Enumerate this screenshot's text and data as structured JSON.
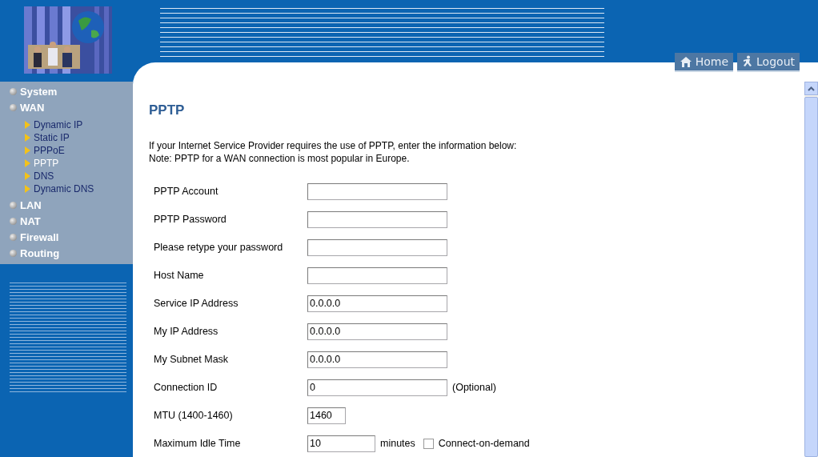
{
  "header": {
    "buttons": [
      {
        "label": "Home",
        "kind": "home"
      },
      {
        "label": "Logout",
        "kind": "logout"
      }
    ]
  },
  "sidebar": {
    "items": [
      {
        "label": "System"
      },
      {
        "label": "WAN",
        "children": [
          {
            "label": "Dynamic IP",
            "selected": false
          },
          {
            "label": "Static IP",
            "selected": false
          },
          {
            "label": "PPPoE",
            "selected": false
          },
          {
            "label": "PPTP",
            "selected": true
          },
          {
            "label": "DNS",
            "selected": false
          },
          {
            "label": "Dynamic DNS",
            "selected": false
          }
        ]
      },
      {
        "label": "LAN"
      },
      {
        "label": "NAT"
      },
      {
        "label": "Firewall"
      },
      {
        "label": "Routing"
      }
    ]
  },
  "page": {
    "title": "PPTP",
    "intro": [
      "If your Internet Service Provider requires the use of PPTP, enter the information below:",
      "Note: PPTP for a WAN connection is most popular in Europe."
    ],
    "fields": [
      {
        "label": "PPTP Account",
        "kind": "long"
      },
      {
        "label": "PPTP Password",
        "kind": "long"
      },
      {
        "label": "Please retype your password",
        "kind": "long"
      },
      {
        "label": "Host Name",
        "kind": "long"
      },
      {
        "label": "Service IP Address",
        "kind": "long",
        "value": "0.0.0.0"
      },
      {
        "label": "My IP Address",
        "kind": "long",
        "value": "0.0.0.0"
      },
      {
        "label": "My Subnet Mask",
        "kind": "long",
        "value": "0.0.0.0"
      },
      {
        "label": "Connection ID",
        "kind": "long",
        "value": "0",
        "note": "(Optional)"
      },
      {
        "label": "MTU (1400-1460)",
        "kind": "short",
        "value": "1460"
      },
      {
        "label": "Maximum Idle Time",
        "kind": "medium",
        "value": "10",
        "note": "minutes",
        "checkbox": {
          "label": "Connect-on-demand",
          "checked": false
        }
      }
    ]
  }
}
